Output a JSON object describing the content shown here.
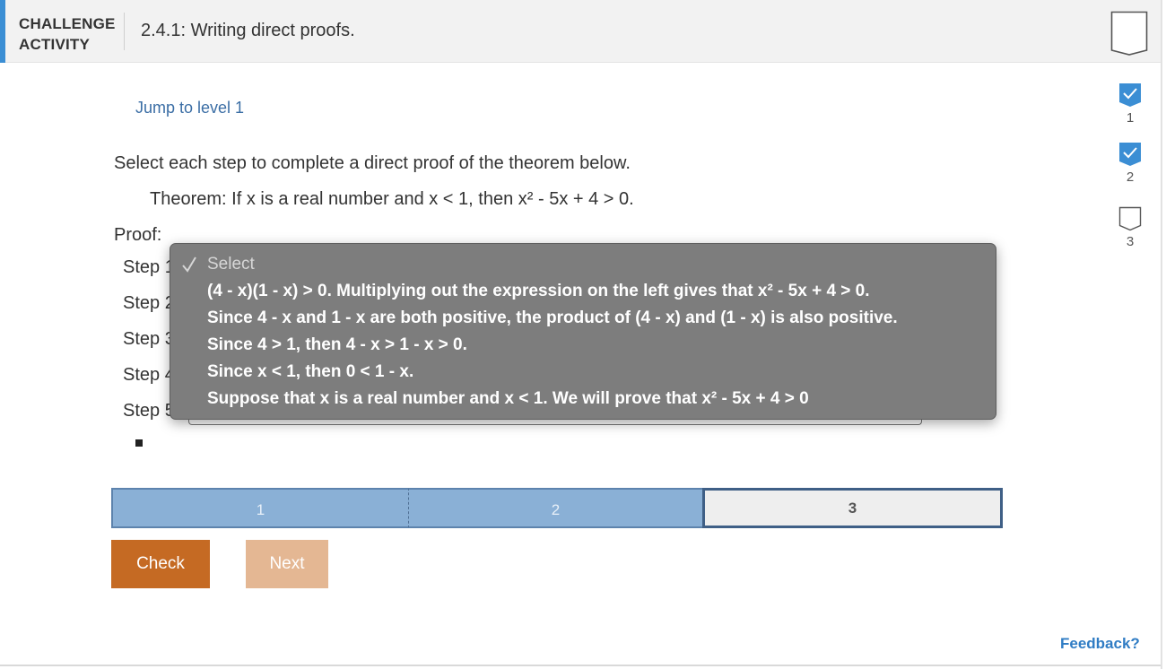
{
  "header": {
    "type_line1": "CHALLENGE",
    "type_line2": "ACTIVITY",
    "title": "2.4.1: Writing direct proofs.",
    "accent_color": "#3b8ed4",
    "bookmark_icon": "bookmark-icon"
  },
  "levels": [
    {
      "number": "1",
      "status": "completed",
      "icon": "check-icon"
    },
    {
      "number": "2",
      "status": "completed",
      "icon": "check-icon"
    },
    {
      "number": "3",
      "status": "current",
      "icon": "empty-level-icon"
    }
  ],
  "content": {
    "jump_link": "Jump to level 1",
    "instructions": "Select each step to complete a direct proof of the theorem below.",
    "theorem": "Theorem: If x is a real number and x < 1, then x² - 5x + 4 > 0.",
    "proof_label": "Proof:",
    "steps": [
      "Step 1",
      "Step 2",
      "Step 3",
      "Step 4",
      "Step 5"
    ]
  },
  "dropdown": {
    "placeholder": "Select",
    "options": [
      "(4 - x)(1 - x) > 0. Multiplying out the expression on the left gives that x² - 5x + 4 > 0.",
      "Since 4 - x and 1 - x are both positive, the product of (4 - x) and (1 - x) is also positive.",
      "Since 4 > 1, then 4 - x > 1 - x > 0.",
      "Since x < 1, then 0 < 1 - x.",
      "Suppose that x is a real number and x < 1. We will prove that x² - 5x + 4 > 0"
    ]
  },
  "progress": {
    "segments": [
      {
        "label": "1",
        "status": "done"
      },
      {
        "label": "2",
        "status": "done"
      },
      {
        "label": "3",
        "status": "current"
      }
    ],
    "done_color": "#8ab0d6"
  },
  "buttons": {
    "check": "Check",
    "next": "Next",
    "check_color": "#c56a23",
    "next_color": "#e4b793"
  },
  "feedback": "Feedback?"
}
